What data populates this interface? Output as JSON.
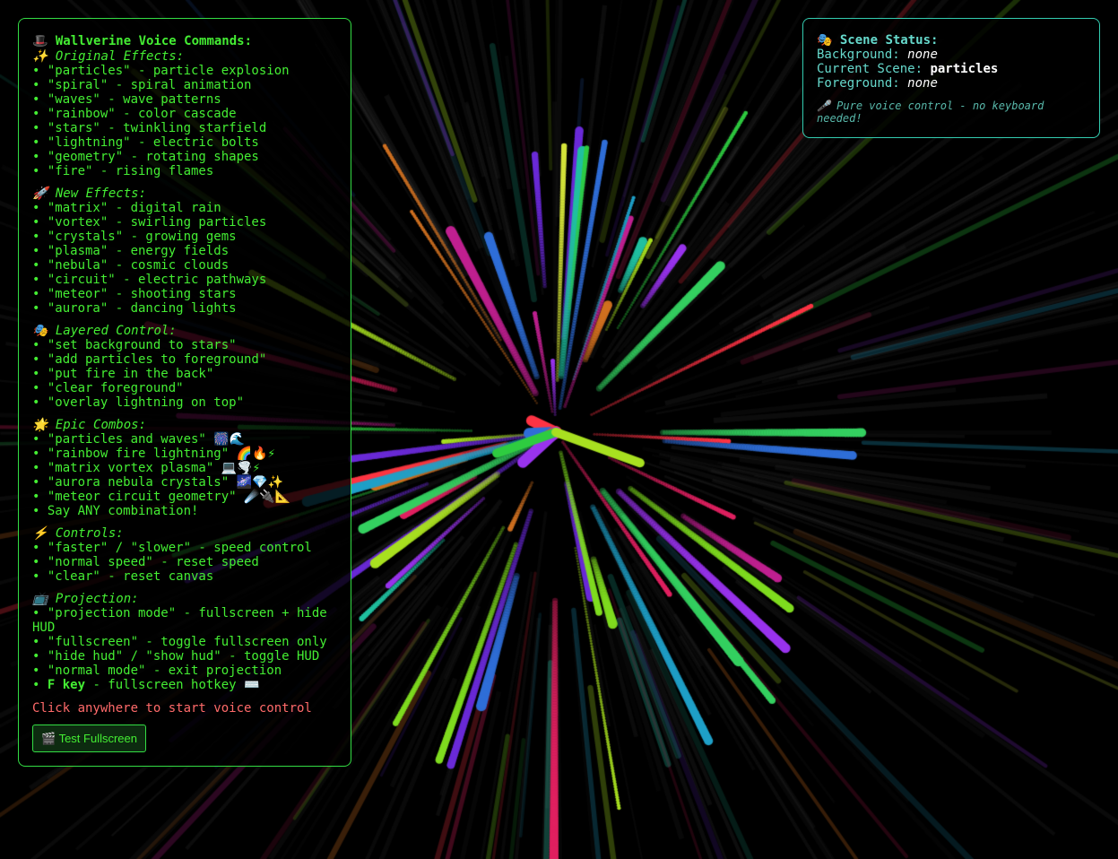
{
  "hud": {
    "title_icon": "🎩",
    "title": "Wallverine Voice Commands:",
    "sections": [
      {
        "icon": "✨",
        "heading": "Original Effects:",
        "items": [
          "• \"particles\" - particle explosion",
          "• \"spiral\" - spiral animation",
          "• \"waves\" - wave patterns",
          "• \"rainbow\" - color cascade",
          "• \"stars\" - twinkling starfield",
          "• \"lightning\" - electric bolts",
          "• \"geometry\" - rotating shapes",
          "• \"fire\" - rising flames"
        ]
      },
      {
        "icon": "🚀",
        "heading": "New Effects:",
        "items": [
          "• \"matrix\" - digital rain",
          "• \"vortex\" - swirling particles",
          "• \"crystals\" - growing gems",
          "• \"plasma\" - energy fields",
          "• \"nebula\" - cosmic clouds",
          "• \"circuit\" - electric pathways",
          "• \"meteor\" - shooting stars",
          "• \"aurora\" - dancing lights"
        ]
      },
      {
        "icon": "🎭",
        "heading": "Layered Control:",
        "items": [
          "• \"set background to stars\"",
          "• \"add particles to foreground\"",
          "• \"put fire in the back\"",
          "• \"clear foreground\"",
          "• \"overlay lightning on top\""
        ]
      },
      {
        "icon": "🌟",
        "heading": "Epic Combos:",
        "items": [
          "• \"particles and waves\" 🎆🌊",
          "• \"rainbow fire lightning\" 🌈🔥⚡",
          "• \"matrix vortex plasma\" 💻🌪️⚡",
          "• \"aurora nebula crystals\" 🌌💎✨",
          "• \"meteor circuit geometry\" ☄️🔌📐",
          "• Say ANY combination!"
        ]
      },
      {
        "icon": "⚡",
        "heading": "Controls:",
        "items": [
          "• \"faster\" / \"slower\" - speed control",
          "• \"normal speed\" - reset speed",
          "• \"clear\" - reset canvas"
        ]
      },
      {
        "icon": "📺",
        "heading": "Projection:",
        "items": [
          "• \"projection mode\" - fullscreen + hide HUD",
          "• \"fullscreen\" - toggle fullscreen only",
          "• \"hide hud\" / \"show hud\" - toggle HUD",
          "• \"normal mode\" - exit projection"
        ]
      }
    ],
    "fkey": {
      "prefix": "• ",
      "key": "F key",
      "desc": " - fullscreen hotkey ⌨️"
    },
    "click_hint": "Click anywhere to start voice control",
    "test_button": "🎬 Test Fullscreen"
  },
  "status": {
    "icon": "🎭",
    "title": "Scene Status:",
    "background_label": "Background:",
    "background_value": "none",
    "scene_label": "Current Scene:",
    "scene_value": "particles",
    "foreground_label": "Foreground:",
    "foreground_value": "none",
    "note": "🎤 Pure voice control - no keyboard needed!"
  },
  "colors": {
    "hud_accent": "#44ee33",
    "status_accent": "#66d9cc",
    "hint": "#ff6a6a",
    "background": "#000000"
  }
}
